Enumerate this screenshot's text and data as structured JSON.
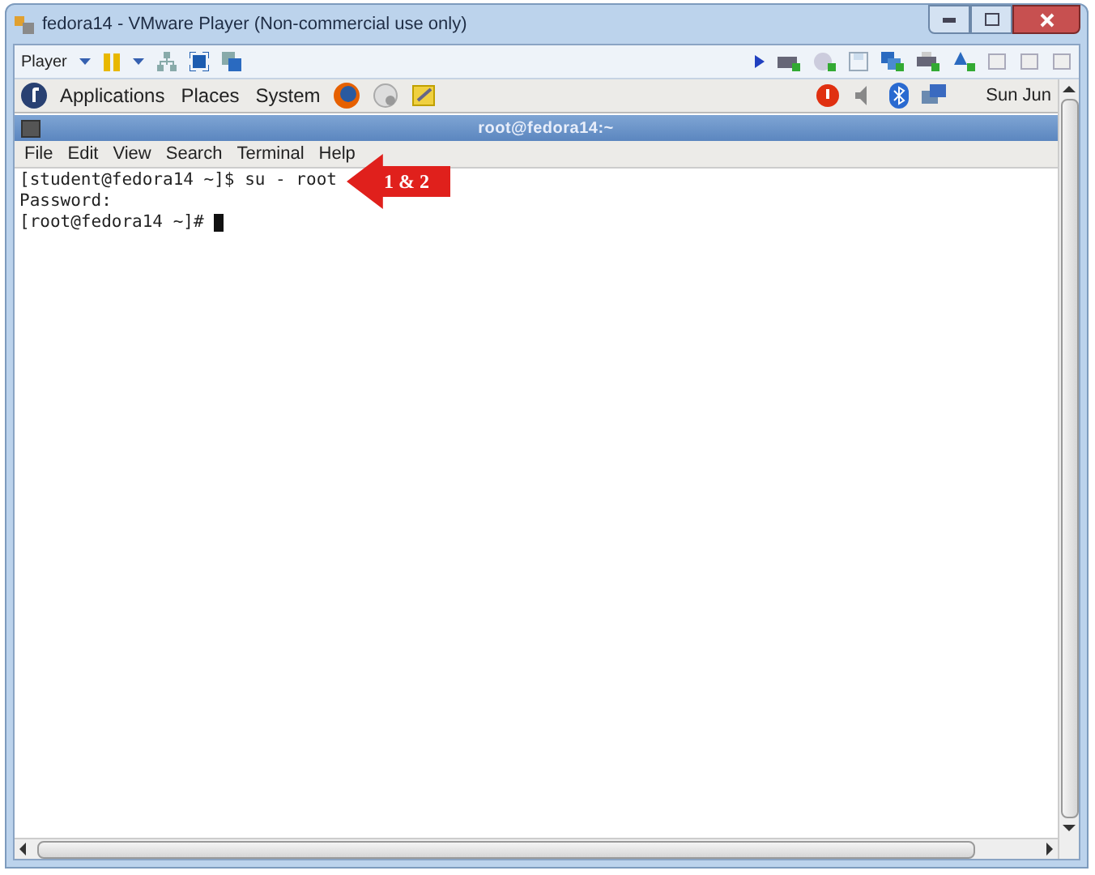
{
  "window": {
    "title": "fedora14 - VMware Player (Non-commercial use only)"
  },
  "toolbar": {
    "player_menu": "Player"
  },
  "panel": {
    "menus": [
      "Applications",
      "Places",
      "System"
    ],
    "clock": "Sun Jun"
  },
  "terminal": {
    "title": "root@fedora14:~",
    "menu": [
      "File",
      "Edit",
      "View",
      "Search",
      "Terminal",
      "Help"
    ],
    "lines": [
      {
        "text": "[student@fedora14 ~]$ su - root",
        "cursor": false
      },
      {
        "text": "Password:",
        "cursor": false
      },
      {
        "text": "[root@fedora14 ~]# ",
        "cursor": true
      }
    ]
  },
  "annotation": {
    "label": "1 & 2"
  }
}
